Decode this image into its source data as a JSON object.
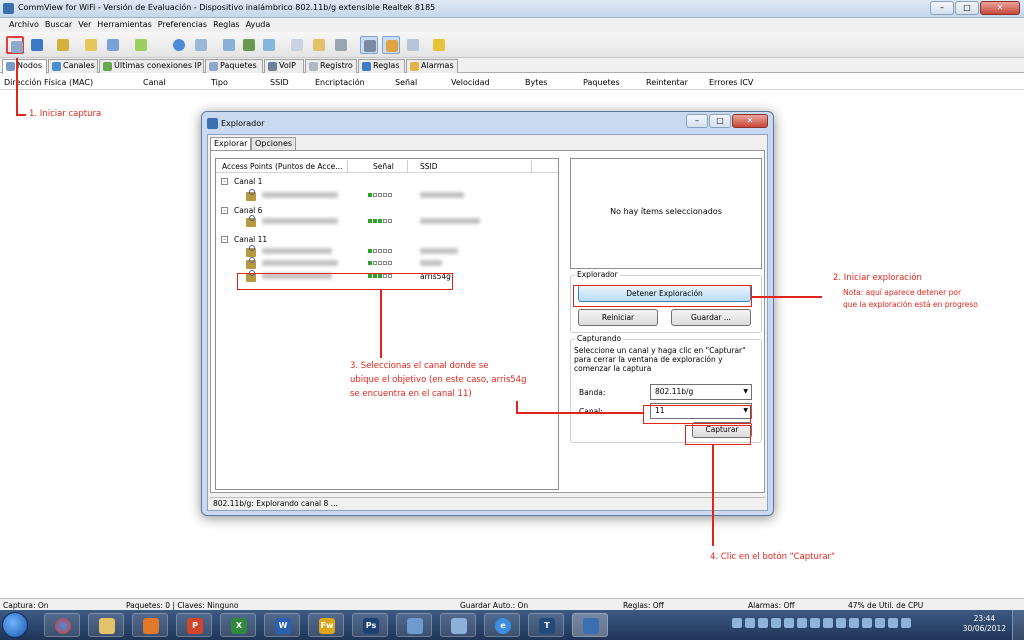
{
  "window": {
    "title": "CommView for WiFi - Versión de Evaluación - Dispositivo inalámbrico 802.11b/g extensible Realtek 8185"
  },
  "menu": [
    "Archivo",
    "Buscar",
    "Ver",
    "Herramientas",
    "Preferencias",
    "Reglas",
    "Ayuda"
  ],
  "tabs": [
    "Nodos",
    "Canales",
    "Últimas conexiones IP",
    "Paquetes",
    "VoIP",
    "Registro",
    "Reglas",
    "Alarmas"
  ],
  "columns": [
    "Dirección Física (MAC)",
    "Canal",
    "Tipo",
    "SSID",
    "Encriptación",
    "Señal",
    "Velocidad",
    "Bytes",
    "Paquetes",
    "Reintentar",
    "Errores ICV"
  ],
  "status": {
    "capture": "Captura: On",
    "packets": "Paquetes: 0 | Claves: Ninguno",
    "autosave": "Guardar Auto.: On",
    "rules": "Reglas: Off",
    "alarms": "Alarmas: Off",
    "cpu": "47% de Util. de CPU"
  },
  "clock": {
    "time": "23:44",
    "date": "30/06/2012"
  },
  "dialog": {
    "title": "Explorador",
    "tabs": [
      "Explorar",
      "Opciones"
    ],
    "list_headers": {
      "ap": "Access Points (Puntos de Acce...",
      "signal": "Señal",
      "ssid": "SSID"
    },
    "channels": [
      {
        "label": "Canal 1",
        "aps": [
          {
            "signal": 1,
            "ssid": ""
          }
        ]
      },
      {
        "label": "Canal 6",
        "aps": [
          {
            "signal": 3,
            "ssid": ""
          }
        ]
      },
      {
        "label": "Canal 11",
        "aps": [
          {
            "signal": 1,
            "ssid": ""
          },
          {
            "signal": 1,
            "ssid": ""
          },
          {
            "signal": 3,
            "ssid": "arris54g"
          }
        ]
      }
    ],
    "no_items": "No hay ítems seleccionados",
    "explorer_group": "Explorador",
    "stop_button": "Detener Exploración",
    "restart_button": "Reiniciar",
    "save_button": "Guardar ...",
    "capture_group": "Capturando",
    "capture_text": "Seleccione un canal y haga clic en \"Capturar\" para cerrar la ventana de exploración y comenzar la captura",
    "band_label": "Banda:",
    "band_value": "802.11b/g",
    "channel_label": "Canal:",
    "channel_value": "11",
    "capture_button": "Capturar",
    "statusbar": "802.11b/g: Explorando canal 8 ..."
  },
  "annotations": {
    "step1": "1. Iniciar captura",
    "step2": "2. Iniciar exploración",
    "step2_note1": "Nota: aquí aparece detener por",
    "step2_note2": "que la exploración está en progreso",
    "step3_l1": "3. Seleccionas el canal donde se",
    "step3_l2": "ubique el objetivo (en este caso, arris54g",
    "step3_l3": "se encuentra en el canal 11)",
    "step4": "4. Clic en el botón \"Capturar\""
  },
  "colors": {
    "annotation": "#e0261c",
    "signal_on": "#2aa52a"
  }
}
